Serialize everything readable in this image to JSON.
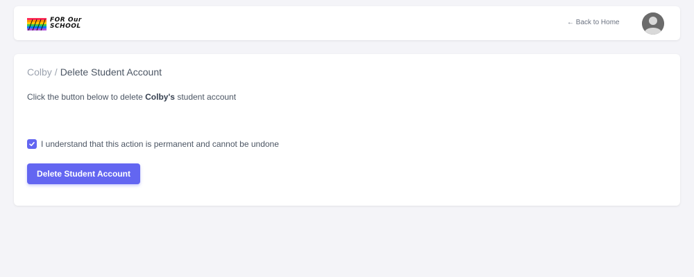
{
  "header": {
    "logo_line1": "FOR Our",
    "logo_line2": "SCHOOL",
    "back_link": "← Back to Home"
  },
  "breadcrumb": {
    "parent": "Colby",
    "separator": "/",
    "current": "Delete Student Account"
  },
  "description": {
    "prefix": "Click the button below to delete ",
    "name": "Colby's",
    "suffix": " student account"
  },
  "confirm": {
    "label": "I understand that this action is permanent and cannot be undone",
    "checked": true
  },
  "delete_button": {
    "label": "Delete Student Account"
  },
  "colors": {
    "accent": "#6366f1",
    "background": "#f4f4f8"
  }
}
